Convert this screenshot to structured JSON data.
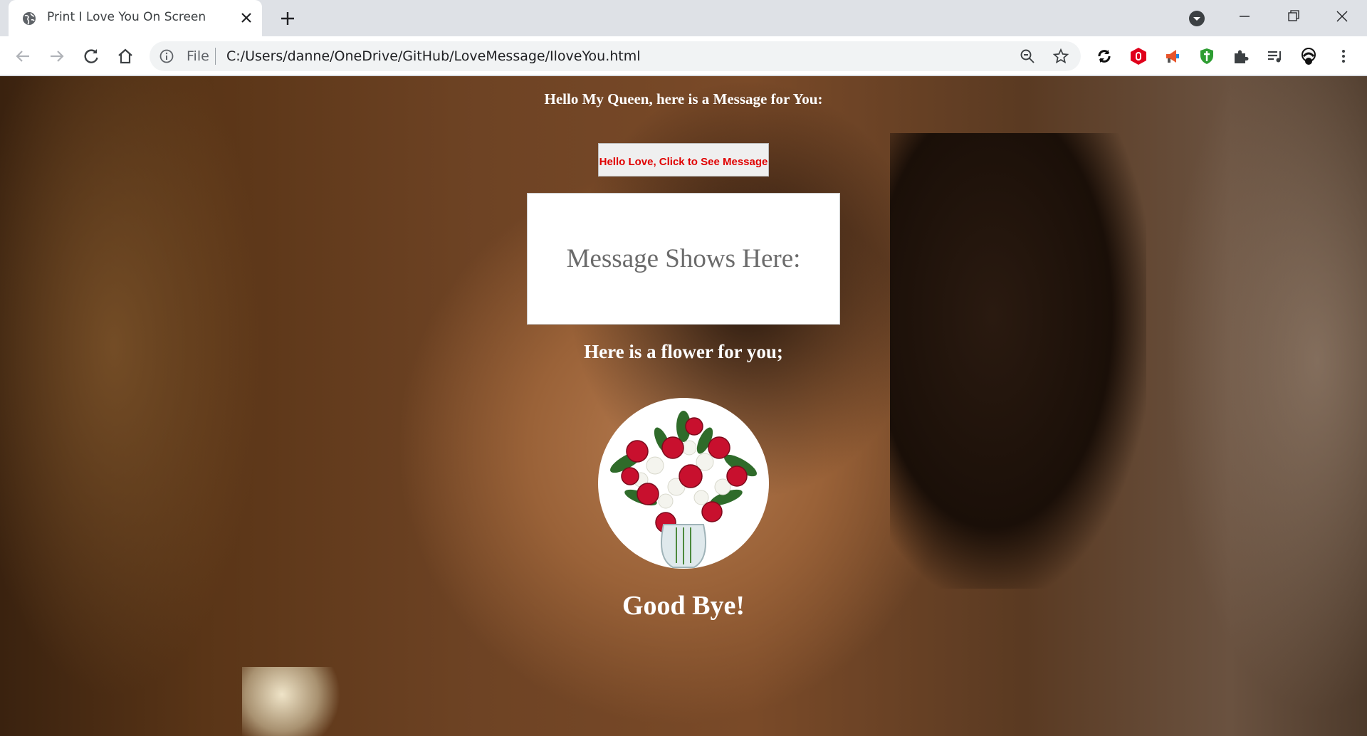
{
  "browser": {
    "tab_title": "Print I Love You On Screen",
    "omnibox_scheme": "File",
    "url": "C:/Users/danne/OneDrive/GitHub/LoveMessage/IloveYou.html"
  },
  "icons": {
    "favicon": "globe-icon",
    "tab_close": "close-icon",
    "new_tab": "plus-icon",
    "tab_search": "tab-search-icon",
    "back": "arrow-left-icon",
    "forward": "arrow-right-icon",
    "reload": "reload-icon",
    "home": "home-icon",
    "site_info": "info-icon",
    "zoom": "zoom-out-icon",
    "bookmark": "star-icon",
    "extensions": [
      "sync-extension-icon",
      "opera-red-extension-icon",
      "megaphone-extension-icon",
      "shield-extension-icon",
      "puzzle-icon",
      "media-control-icon",
      "profile-avatar-icon",
      "kebab-menu-icon"
    ]
  },
  "colors": {
    "button_text": "#e00000",
    "heading_text": "#ffffff",
    "message_text": "#6b6b6b"
  },
  "page": {
    "heading": "Hello My Queen, here is a Message for You:",
    "button_label": "Hello Love, Click to See Message",
    "message_placeholder": "Message Shows Here:",
    "flower_heading": "Here is a flower for you;",
    "goodbye": "Good Bye!"
  }
}
